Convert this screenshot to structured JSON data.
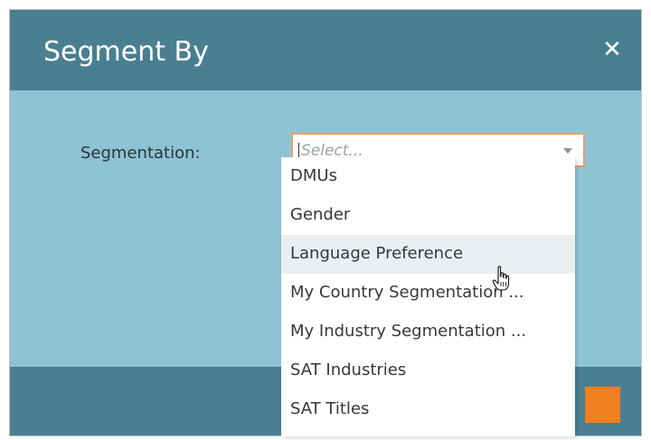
{
  "dialog": {
    "title": "Segment By",
    "close_icon": "close-icon",
    "segmentation_label": "Segmentation:",
    "select": {
      "placeholder": "Select...",
      "arrow_icon": "chevron-down-icon"
    },
    "options": [
      "DMUs",
      "Gender",
      "Language Preference",
      "My Country Segmentation ...",
      "My Industry Segmentation ...",
      "SAT Industries",
      "SAT Titles"
    ],
    "hovered_option": "Language Preference"
  },
  "colors": {
    "header": "#4a7f92",
    "content": "#8ec3d4",
    "accent": "#f07f1f",
    "select_border": "#e5a06a"
  }
}
